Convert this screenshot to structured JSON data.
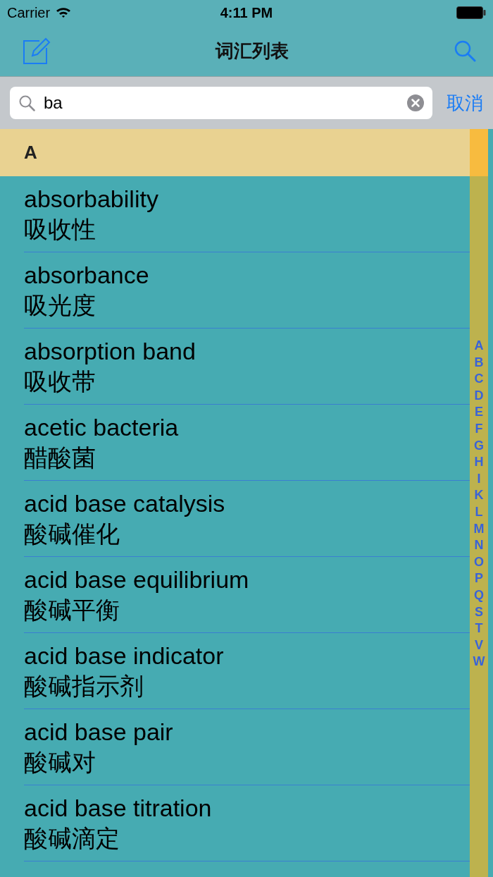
{
  "status_bar": {
    "carrier": "Carrier",
    "time": "4:11 PM"
  },
  "nav_bar": {
    "title": "词汇列表"
  },
  "search": {
    "value": "ba",
    "cancel": "取消"
  },
  "section": {
    "title": "A"
  },
  "rows": [
    {
      "term": "absorbability",
      "translation": "吸收性"
    },
    {
      "term": "absorbance",
      "translation": "吸光度"
    },
    {
      "term": "absorption band",
      "translation": "吸收带"
    },
    {
      "term": "acetic bacteria",
      "translation": "醋酸菌"
    },
    {
      "term": "acid base catalysis",
      "translation": "酸碱催化"
    },
    {
      "term": "acid base equilibrium",
      "translation": "酸碱平衡"
    },
    {
      "term": "acid base indicator",
      "translation": "酸碱指示剂"
    },
    {
      "term": "acid base pair",
      "translation": "酸碱对"
    },
    {
      "term": "acid base titration",
      "translation": "酸碱滴定"
    }
  ],
  "index": [
    "A",
    "B",
    "C",
    "D",
    "E",
    "F",
    "G",
    "H",
    "I",
    "K",
    "L",
    "M",
    "N",
    "O",
    "P",
    "Q",
    "S",
    "T",
    "V",
    "W"
  ]
}
